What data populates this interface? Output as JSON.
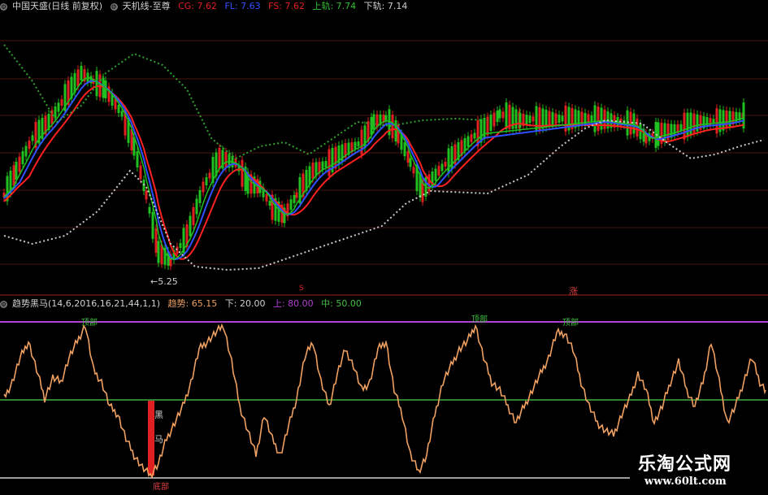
{
  "top_panel": {
    "symbol": "中国天盛(日线 前复权)",
    "indicator_name": "天机线-至尊",
    "cg_label": "CG: 7.62",
    "fl_label": "FL: 7.63",
    "fs_label": "FS: 7.62",
    "upper_label": "上轨: 7.74",
    "lower_label": "下轨: 7.14",
    "low_price_marker": "←5.25",
    "mark_a": "S",
    "mark_b": "涨"
  },
  "bottom_panel": {
    "indicator_label": "趋势黑马(14,6,2016,16,21,44,1,1)",
    "trend_label": "趋势: 65.15",
    "down_label": "下: 20.00",
    "up_label": "上: 80.00",
    "mid_label": "中: 50.00",
    "top_marks": [
      "顶部",
      "顶部",
      "顶部"
    ],
    "bottom_mark": "底部",
    "black_horse_chars": [
      "黑",
      "马"
    ]
  },
  "watermark": {
    "title": "乐淘公式网",
    "url": "www.60lt.com"
  },
  "colors": {
    "background": "#000000",
    "candle_up": "#e02020",
    "candle_down": "#20c020",
    "ma_red": "#ff2020",
    "ma_blue": "#3050ff",
    "ma_green": "#20c020",
    "band_green": "#30a030",
    "band_white": "#c8c8c8",
    "osc_line": "#f0a060",
    "level_up": "#b040d0",
    "level_mid": "#40b040",
    "level_down": "#d0d0d0",
    "grid": "#5a1818"
  }
}
